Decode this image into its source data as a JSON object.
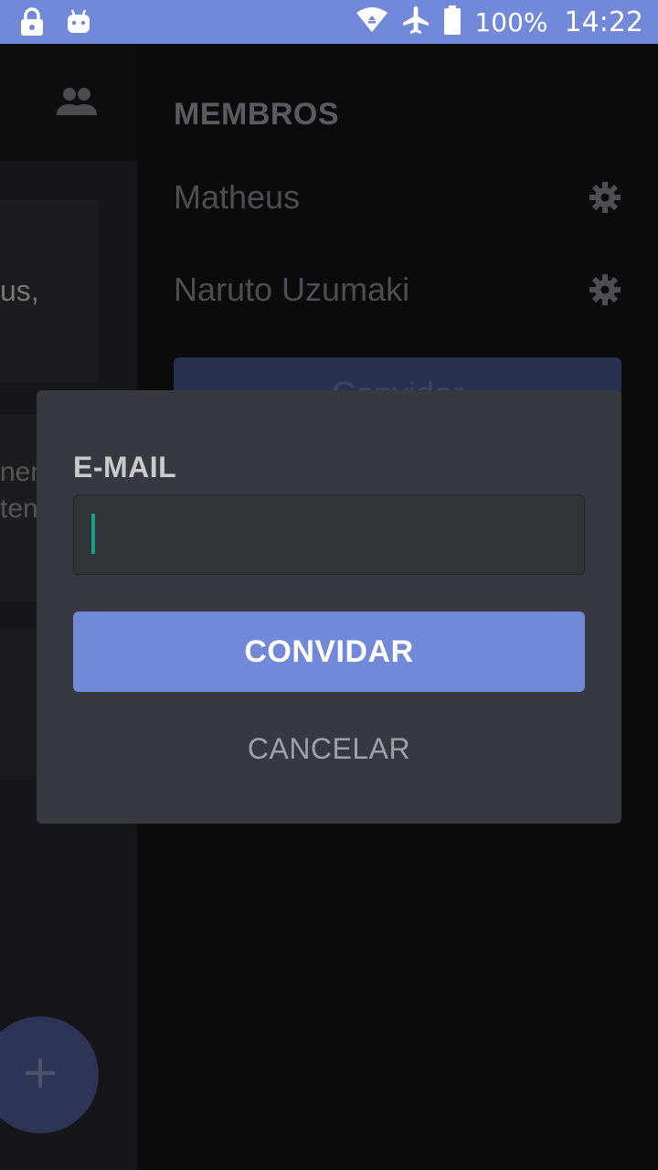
{
  "status_bar": {
    "battery_percent": "100%",
    "time": "14:22",
    "icons": [
      "lock-icon",
      "android-debug-icon",
      "wifi-icon",
      "airplane-mode-icon",
      "battery-icon"
    ]
  },
  "background": {
    "left_card1_fragment": "us,",
    "left_card2_fragment1": "nent",
    "left_card2_fragment2": "ten",
    "members_header": "MEMBROS",
    "members": [
      {
        "name": "Matheus"
      },
      {
        "name": "Naruto Uzumaki"
      }
    ],
    "invite_strip_fragment": "Convidar"
  },
  "dialog": {
    "email_label": "E-MAIL",
    "email_value": "",
    "invite_label": "CONVIDAR",
    "cancel_label": "CANCELAR"
  },
  "colors": {
    "accent": "#7289da",
    "dialog_bg": "#36393f",
    "caret": "#1a9e8a"
  }
}
